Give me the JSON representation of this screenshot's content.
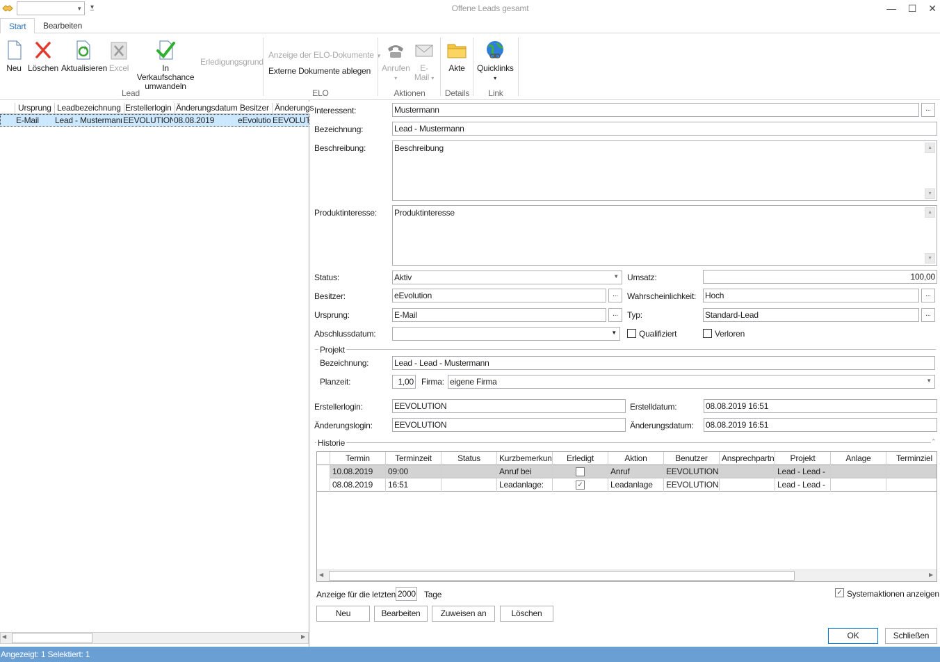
{
  "window": {
    "title": "Offene Leads gesamt"
  },
  "tabs": [
    {
      "label": "Start"
    },
    {
      "label": "Bearbeiten"
    }
  ],
  "ribbon": {
    "buttons": {
      "neu": "Neu",
      "loeschen": "Löschen",
      "aktualisieren": "Aktualisieren",
      "excel": "Excel",
      "verkaufschance_1": "In Verkaufschance",
      "verkaufschance_2": "umwandeln",
      "erledigungsgrund": "Erledigungsgrund",
      "elo_anzeige": "Anzeige der ELO-Dokumente",
      "elo_ablegen": "Externe Dokumente ablegen",
      "anrufen": "Anrufen",
      "email_1": "E-",
      "email_2": "Mail",
      "akte": "Akte",
      "quicklinks": "Quicklinks"
    },
    "groups": {
      "lead": "Lead",
      "elo": "ELO",
      "aktionen": "Aktionen",
      "details": "Details",
      "link": "Link"
    }
  },
  "list": {
    "columns": [
      "Ursprung",
      "Leadbezeichnung",
      "Erstellerlogin",
      "Änderungsdatum",
      "Besitzer",
      "Änderungs"
    ],
    "row": [
      "E-Mail",
      "Lead - Mustermann",
      "EEVOLUTION",
      "08.08.2019",
      "eEvolution",
      "EEVOLUTION"
    ]
  },
  "form": {
    "labels": {
      "interessent": "Interessent:",
      "bezeichnung": "Bezeichnung:",
      "beschreibung": "Beschreibung:",
      "produktinteresse": "Produktinteresse:",
      "status": "Status:",
      "umsatz": "Umsatz:",
      "besitzer": "Besitzer:",
      "wahrscheinlichkeit": "Wahrscheinlichkeit:",
      "ursprung": "Ursprung:",
      "typ": "Typ:",
      "abschlussdatum": "Abschlussdatum:",
      "qualifiziert": "Qualifiziert",
      "verloren": "Verloren",
      "projekt": "Projekt",
      "p_bezeichnung": "Bezeichnung:",
      "planzeit": "Planzeit:",
      "firma": "Firma:",
      "erstellerlogin": "Erstellerlogin:",
      "erstelldatum": "Erstelldatum:",
      "aenderungslogin": "Änderungslogin:",
      "aenderungsdatum": "Änderungsdatum:"
    },
    "values": {
      "interessent": "Mustermann",
      "bezeichnung": "Lead - Mustermann",
      "beschreibung": "Beschreibung",
      "produktinteresse": "Produktinteresse",
      "status": "Aktiv",
      "umsatz": "100,00",
      "besitzer": "eEvolution",
      "wahrscheinlichkeit": "Hoch",
      "ursprung": "E-Mail",
      "typ": "Standard-Lead",
      "abschlussdatum": "",
      "p_bezeichnung": "Lead - Lead - Mustermann",
      "planzeit": "1,00",
      "firma": "eigene Firma",
      "erstellerlogin": "EEVOLUTION",
      "erstelldatum": "08.08.2019 16:51",
      "aenderungslogin": "EEVOLUTION",
      "aenderungsdatum": "08.08.2019 16:51"
    },
    "browse": "..."
  },
  "historie": {
    "title": "Historie",
    "columns": [
      "Termin",
      "Terminzeit",
      "Status",
      "Kurzbemerkung",
      "Erledigt",
      "Aktion",
      "Benutzer",
      "Ansprechpartner",
      "Projekt",
      "Anlage",
      "Terminziel"
    ],
    "rows": [
      {
        "termin": "10.08.2019",
        "zeit": "09:00",
        "status": "",
        "kurz": "Anruf bei",
        "erledigt": false,
        "aktion": "Anruf",
        "benutzer": "EEVOLUTION",
        "ansprech": "",
        "projekt": "Lead - Lead -",
        "anlage": "",
        "ziel": ""
      },
      {
        "termin": "08.08.2019",
        "zeit": "16:51",
        "status": "",
        "kurz": "Leadanlage:",
        "erledigt": true,
        "aktion": "Leadanlage",
        "benutzer": "EEVOLUTION",
        "ansprech": "",
        "projekt": "Lead - Lead -",
        "anlage": "",
        "ziel": ""
      }
    ],
    "anzeige_label": "Anzeige für die letzten",
    "anzeige_value": "2000",
    "tage": "Tage",
    "systemaktionen": "Systemaktionen anzeigen",
    "systemaktionen_checked": true,
    "buttons": {
      "neu": "Neu",
      "bearbeiten": "Bearbeiten",
      "zuweisen": "Zuweisen an",
      "loeschen": "Löschen"
    }
  },
  "dialog": {
    "ok": "OK",
    "schliessen": "Schließen"
  },
  "status": {
    "text": "Angezeigt: 1 Selektiert: 1"
  },
  "colors": {
    "accent": "#2a74b9",
    "statusbar": "#6a9fd4",
    "selection": "#cce8ff"
  }
}
